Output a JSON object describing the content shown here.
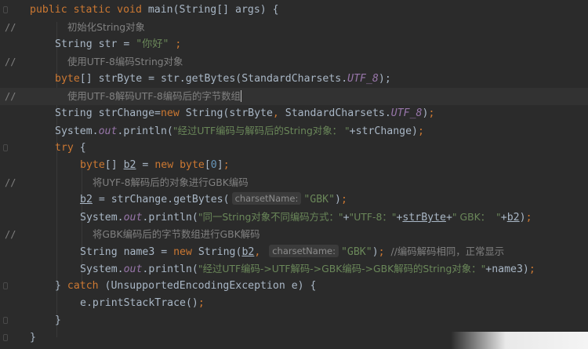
{
  "editor": {
    "lines": [
      {
        "marker": "",
        "segments": [
          [
            "kw",
            "public static void "
          ],
          [
            "pl",
            "main(String[] args) {"
          ]
        ]
      },
      {
        "marker": "//",
        "segments": [
          [
            "cmt cn",
            "初始化String对象"
          ]
        ]
      },
      {
        "marker": "",
        "segments": [
          [
            "pl",
            "String str = "
          ],
          [
            "str",
            "\"你好\""
          ],
          [
            "kw",
            " ;"
          ]
        ]
      },
      {
        "marker": "//",
        "segments": [
          [
            "cmt cn",
            "使用UTF-8编码String对象"
          ]
        ]
      },
      {
        "marker": "",
        "segments": [
          [
            "kw",
            "byte"
          ],
          [
            "pl",
            "[] strByte = str.getBytes(StandardCharsets."
          ],
          [
            "fld",
            "UTF_8"
          ],
          [
            "pl",
            ");"
          ]
        ]
      },
      {
        "marker": "//",
        "segments": [
          [
            "cmt cn",
            "使用UTF-8解码UTF-8编码后的字节数组"
          ]
        ]
      },
      {
        "marker": "",
        "segments": [
          [
            "pl",
            "String strChange="
          ],
          [
            "kw",
            "new "
          ],
          [
            "pl",
            "String(strByte"
          ],
          [
            "kw",
            ", "
          ],
          [
            "pl",
            "StandardCharsets."
          ],
          [
            "fld",
            "UTF_8"
          ],
          [
            "pl",
            ")"
          ],
          [
            "kw",
            ";"
          ]
        ]
      },
      {
        "marker": "",
        "segments": [
          [
            "pl",
            "System."
          ],
          [
            "fld",
            "out"
          ],
          [
            "pl",
            ".println("
          ],
          [
            "str cn",
            "\"经过UTF编码与解码后的String对象： \""
          ],
          [
            "pl",
            "+strChange)"
          ],
          [
            "kw",
            ";"
          ]
        ]
      },
      {
        "marker": "",
        "segments": [
          [
            "kw",
            "try "
          ],
          [
            "pl",
            "{"
          ]
        ]
      },
      {
        "marker": "",
        "segments": [
          [
            "kw",
            "byte"
          ],
          [
            "pl",
            "[] "
          ],
          [
            "var",
            "b2"
          ],
          [
            "pl",
            " = "
          ],
          [
            "kw",
            "new byte"
          ],
          [
            "pl",
            "["
          ],
          [
            "num",
            "0"
          ],
          [
            "pl",
            "]"
          ],
          [
            "kw",
            ";"
          ]
        ]
      },
      {
        "marker": "//",
        "segments": [
          [
            "cmt cn",
            "将UYF-8解码后的对象进行GBK编码"
          ]
        ]
      },
      {
        "marker": "",
        "segments": [
          [
            "var",
            "b2"
          ],
          [
            "pl",
            " = strChange.getBytes("
          ],
          [
            "hint",
            "charsetName:"
          ],
          [
            "str",
            "\"GBK\""
          ],
          [
            "pl",
            ")"
          ],
          [
            "kw",
            ";"
          ]
        ]
      },
      {
        "marker": "",
        "segments": [
          [
            "pl",
            "System."
          ],
          [
            "fld",
            "out"
          ],
          [
            "pl",
            ".println("
          ],
          [
            "str cn",
            "\"同一String对象不同编码方式：\""
          ],
          [
            "pl",
            "+"
          ],
          [
            "str cn",
            "\"UTF-8：\""
          ],
          [
            "pl",
            "+"
          ],
          [
            "var",
            "strByte"
          ],
          [
            "pl",
            "+"
          ],
          [
            "str cn",
            "\" GBK：  \""
          ],
          [
            "pl",
            "+"
          ],
          [
            "var",
            "b2"
          ],
          [
            "pl",
            ")"
          ],
          [
            "kw",
            ";"
          ]
        ]
      },
      {
        "marker": "//",
        "segments": [
          [
            "cmt cn",
            "将GBK编码后的字节数组进行GBK解码"
          ]
        ]
      },
      {
        "marker": "",
        "segments": [
          [
            "pl",
            "String name3 = "
          ],
          [
            "kw",
            "new "
          ],
          [
            "pl",
            "String("
          ],
          [
            "var",
            "b2"
          ],
          [
            "kw",
            ", "
          ],
          [
            "hint",
            "charsetName:"
          ],
          [
            "str",
            "\"GBK\""
          ],
          [
            "pl",
            ")"
          ],
          [
            "kw",
            "; "
          ],
          [
            "cmt cn",
            "//编码解码相同，正常显示"
          ]
        ]
      },
      {
        "marker": "",
        "segments": [
          [
            "pl",
            "System."
          ],
          [
            "fld",
            "out"
          ],
          [
            "pl",
            ".println("
          ],
          [
            "str cn",
            "\"经过UTF编码->UTF解码->GBK编码->GBK解码的String对象：\""
          ],
          [
            "pl",
            "+name3)"
          ],
          [
            "kw",
            ";"
          ]
        ]
      },
      {
        "marker": "",
        "segments": [
          [
            "pl",
            "} "
          ],
          [
            "kw",
            "catch "
          ],
          [
            "pl",
            "(UnsupportedEncodingException e) {"
          ]
        ]
      },
      {
        "marker": "",
        "segments": [
          [
            "pl",
            "e.printStackTrace()"
          ],
          [
            "kw",
            ";"
          ]
        ]
      },
      {
        "marker": "",
        "segments": [
          [
            "pl",
            "}"
          ]
        ]
      },
      {
        "marker": "",
        "segments": [
          [
            "pl",
            "}"
          ]
        ]
      }
    ]
  },
  "colors": {
    "background": "#2b2b2b",
    "keyword": "#cc7832",
    "string": "#6a8759",
    "static_field": "#9876aa",
    "comment": "#808080",
    "number": "#6897bb",
    "plain": "#a9b7c6"
  }
}
